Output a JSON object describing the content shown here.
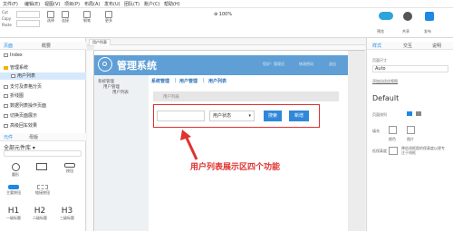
{
  "menu": [
    "文件(F)",
    "编辑(E)",
    "视图(V)",
    "项目(P)",
    "布局(A)",
    "发布(U)",
    "团队(T)",
    "账户(C)",
    "帮助(H)"
  ],
  "toolbar": {
    "left_group": [
      "Cut",
      "Copy",
      "Paste"
    ],
    "tools": [
      "选择",
      "连接",
      "钢笔",
      "更多",
      "缩放"
    ],
    "zoom": "100%",
    "right_group": [
      "预览",
      "共享",
      "发布"
    ]
  },
  "left_panel": {
    "tabs": [
      "页面",
      "概要"
    ],
    "pages": [
      {
        "label": "Index",
        "depth": 0
      },
      {
        "label": "管理系统",
        "depth": 0
      },
      {
        "label": "用户列表",
        "depth": 1,
        "selected": true
      },
      {
        "label": "支付及表格分页",
        "depth": 0
      },
      {
        "label": "折线图",
        "depth": 0
      },
      {
        "label": "数据列表操作页面",
        "depth": 0
      },
      {
        "label": "切换页面展示",
        "depth": 0
      },
      {
        "label": "高级回车效果",
        "depth": 0
      }
    ],
    "lib_tabs": [
      "元件",
      "母版"
    ],
    "lib_name": "全部元件库",
    "lib_items": [
      {
        "label": "圆形",
        "icon": "circle-icon"
      },
      {
        "label": "占位符",
        "icon": "placeholder-icon"
      },
      {
        "label": "按钮",
        "icon": "button-icon"
      },
      {
        "label": "主要按钮",
        "icon": "primary-button-icon"
      },
      {
        "label": "链接按钮",
        "icon": "link-button-icon"
      },
      {
        "label": "一级标题",
        "icon": "h1-icon",
        "glyph": "H1"
      },
      {
        "label": "二级标题",
        "icon": "h2-icon",
        "glyph": "H2"
      },
      {
        "label": "三级标题",
        "icon": "h3-icon",
        "glyph": "H3"
      }
    ]
  },
  "doc_tab": "用户列表",
  "prototype": {
    "title": "管理系统",
    "header_links": [
      "您好！管理员",
      "修改密码",
      "退出"
    ],
    "sidebar": [
      "系统管理",
      "用户管理",
      "用户列表"
    ],
    "breadcrumb": [
      "系统管理",
      "用户管理",
      "用户列表"
    ],
    "section_title": "用户列表",
    "search_placeholder": "",
    "status_select": "用户状态",
    "search_button": "搜索",
    "add_button": "新增"
  },
  "right_panel": {
    "tabs": [
      "样式",
      "交互",
      "说明"
    ],
    "size_label": "页面尺寸",
    "size_value": "Auto",
    "add_adaptive": "添加自适应视图",
    "style_name": "Default",
    "align_label": "页面排列",
    "fill_label": "填充",
    "fill_options": [
      "颜色",
      "图片"
    ],
    "low_fidelity_label": "低保真度",
    "low_fidelity_desc": "降低线框图的保真度以便专注于线框"
  },
  "annotation": "用户列表展示区四个功能",
  "colors": {
    "accent": "#1e88e5",
    "header": "#5f9fd6",
    "annotation": "#e0322f",
    "primary_btn": "#2f88d8"
  }
}
